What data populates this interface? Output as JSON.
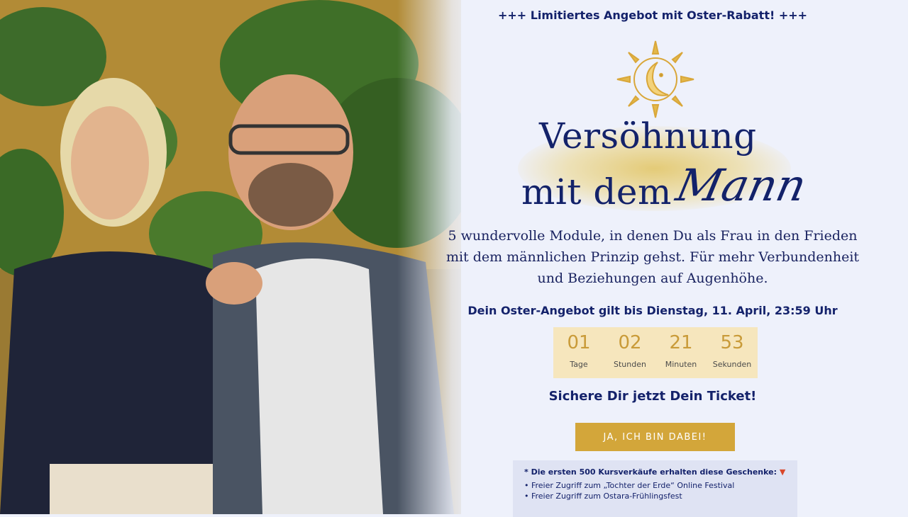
{
  "top_banner": "+++ Limitiertes Angebot mit Oster-Rabatt! +++",
  "hero": {
    "photo_alt": "couple-photo"
  },
  "title": {
    "line1": "Versöhnung",
    "line2": "mit dem",
    "script": "Mann"
  },
  "subtitle": {
    "line1": "5 wundervolle Module, in denen Du als Frau in den Frieden",
    "line2": "mit dem männlichen Prinzip gehst. Für mehr Verbundenheit",
    "line3": "und Beziehungen auf Augenhöhe."
  },
  "offer_deadline": "Dein Oster-Angebot gilt bis Dienstag, 11. April, 23:59 Uhr",
  "countdown": [
    {
      "value": "01",
      "label": "Tage"
    },
    {
      "value": "02",
      "label": "Stunden"
    },
    {
      "value": "21",
      "label": "Minuten"
    },
    {
      "value": "53",
      "label": "Sekunden"
    }
  ],
  "cta_heading": "Sichere Dir jetzt Dein Ticket!",
  "cta_button": "JA, ICH BIN DABEI!",
  "gifts": {
    "heading": "* Die ersten 500 Kursverkäufe erhalten diese Geschenke:",
    "items": [
      "• Freier Zugriff zum „Tochter der Erde“ Online Festival",
      "• Freier Zugriff zum Ostara-Frühlingsfest"
    ]
  },
  "colors": {
    "navy": "#14226b",
    "gold": "#d3a63a",
    "background": "#eef1fb"
  }
}
